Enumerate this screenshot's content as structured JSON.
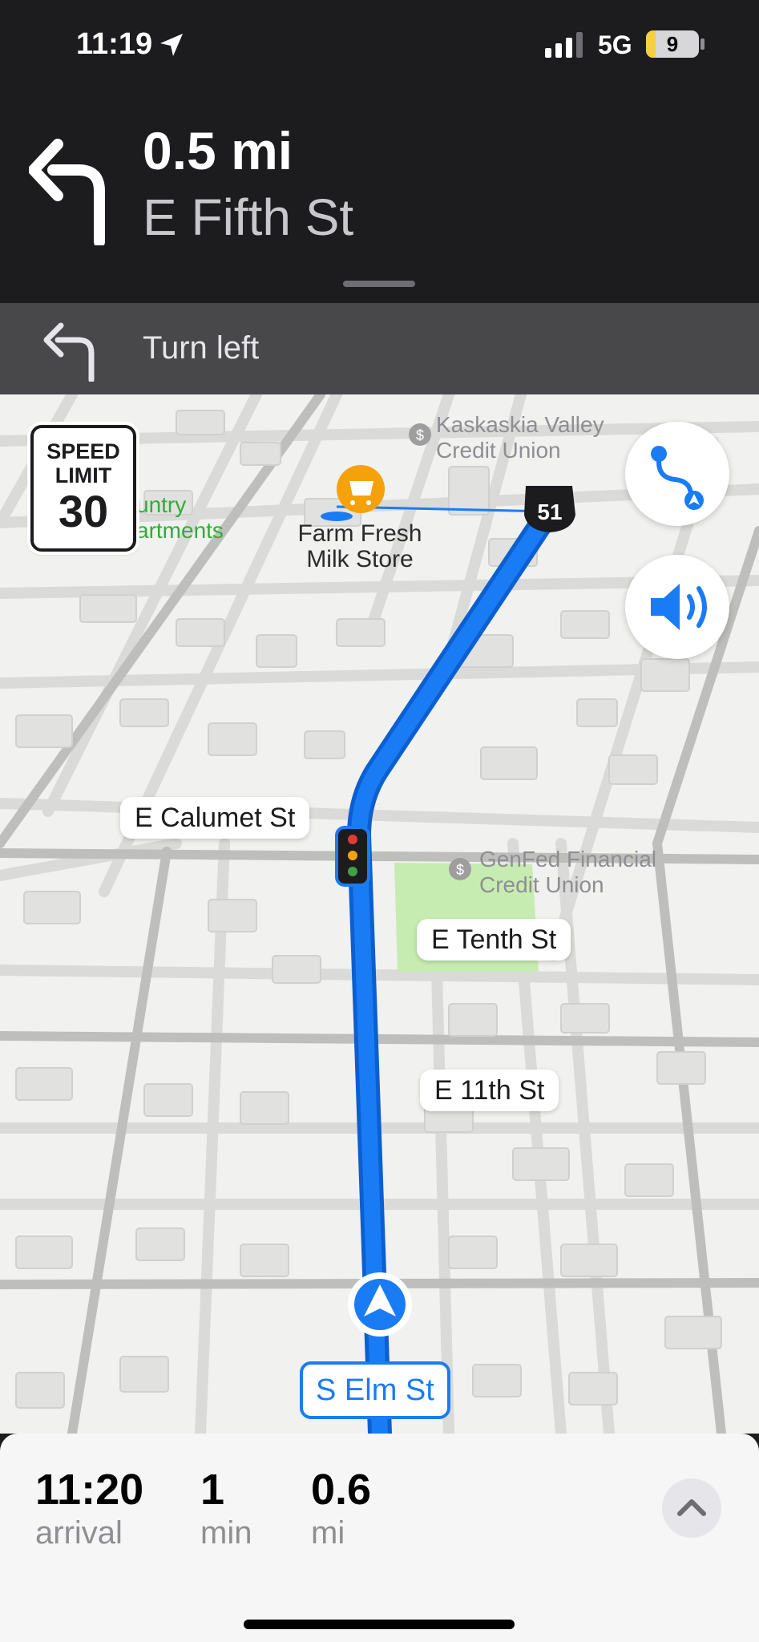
{
  "status_bar": {
    "time": "11:19",
    "network": "5G",
    "battery": "9",
    "battery_level": 0.09,
    "icons": [
      "location-arrow-icon",
      "signal-bars-icon",
      "battery-icon"
    ]
  },
  "maneuver": {
    "distance": "0.5 mi",
    "street": "E Fifth St",
    "icon": "turn-left-arrow-icon"
  },
  "next_step": {
    "instruction": "Turn left",
    "icon": "turn-left-arrow-icon"
  },
  "map": {
    "speed_limit": {
      "line1": "SPEED",
      "line2": "LIMIT",
      "value": "30"
    },
    "poi_bank_1": [
      "Kaskaskia Valley",
      "Credit Union"
    ],
    "poi_bank_2": [
      "GenFed Financial",
      "Credit Union"
    ],
    "poi_store": [
      "Farm Fresh",
      "Milk Store"
    ],
    "poi_partial": [
      "untry",
      "artments"
    ],
    "route_shield": "51",
    "streets": {
      "calumet": "E Calumet St",
      "tenth": "E Tenth St",
      "eleventh": "E 11th St"
    },
    "current_street": "S Elm St",
    "buttons": {
      "overview": "route-overview-icon",
      "audio": "speaker-icon"
    },
    "colors": {
      "route": "#1a7cf5",
      "poi_store": "#f5a20a",
      "park": "#c7ecb1"
    }
  },
  "trip": {
    "arrival_value": "11:20",
    "arrival_label": "arrival",
    "duration_value": "1",
    "duration_label": "min",
    "distance_value": "0.6",
    "distance_label": "mi",
    "expand_icon": "chevron-up-icon"
  }
}
